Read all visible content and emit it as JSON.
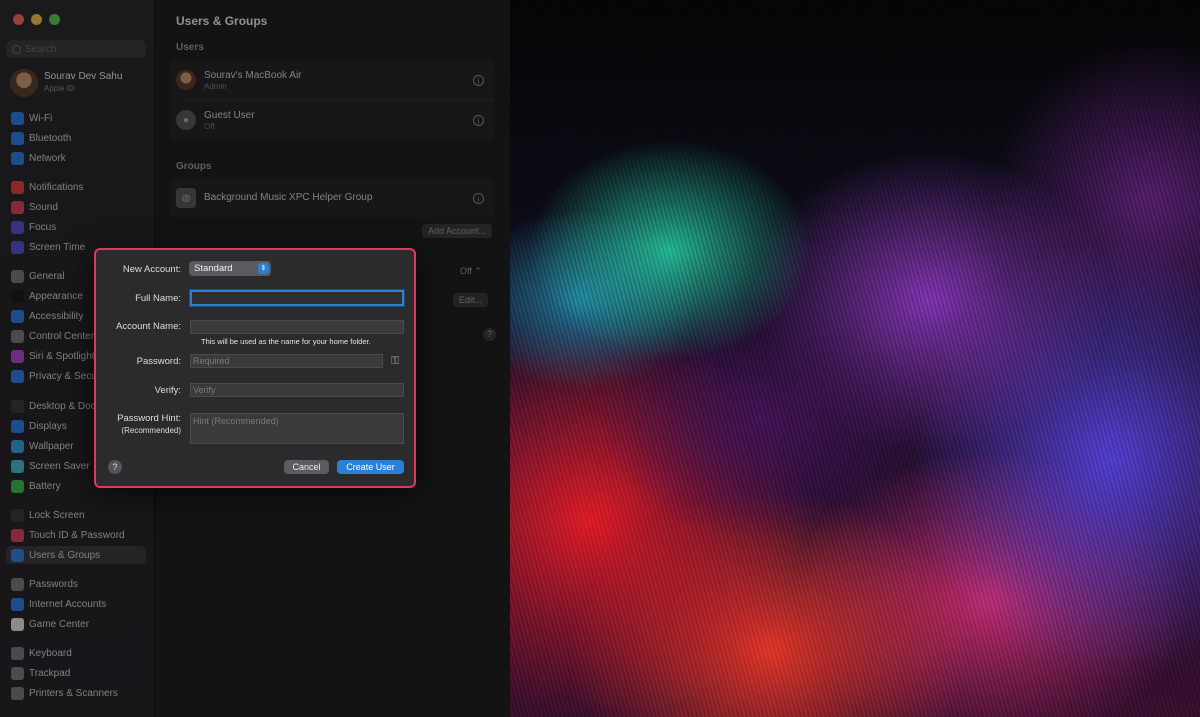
{
  "window": {
    "search_placeholder": "Search",
    "profile": {
      "name": "Sourav Dev Sahu",
      "subtitle": "Apple ID"
    },
    "sidebar": {
      "items": [
        {
          "label": "Wi-Fi",
          "color": "#2f7fe0"
        },
        {
          "label": "Bluetooth",
          "color": "#2f7fe0"
        },
        {
          "label": "Network",
          "color": "#2f7fe0"
        },
        {
          "label": "Notifications",
          "color": "#e04040"
        },
        {
          "label": "Sound",
          "color": "#e04060"
        },
        {
          "label": "Focus",
          "color": "#5a4fd0"
        },
        {
          "label": "Screen Time",
          "color": "#5a4fd0"
        },
        {
          "label": "General",
          "color": "#7a7a7e"
        },
        {
          "label": "Appearance",
          "color": "#1c1c1e"
        },
        {
          "label": "Accessibility",
          "color": "#2f7fe0"
        },
        {
          "label": "Control Center",
          "color": "#7a7a7e"
        },
        {
          "label": "Siri & Spotlight",
          "color": "#b04ad0"
        },
        {
          "label": "Privacy & Security",
          "color": "#2f7fe0"
        },
        {
          "label": "Desktop & Dock",
          "color": "#3a3a3e"
        },
        {
          "label": "Displays",
          "color": "#2f7fe0"
        },
        {
          "label": "Wallpaper",
          "color": "#35a0d8"
        },
        {
          "label": "Screen Saver",
          "color": "#45b8c8"
        },
        {
          "label": "Battery",
          "color": "#3fb950"
        },
        {
          "label": "Lock Screen",
          "color": "#3a3a3e"
        },
        {
          "label": "Touch ID & Password",
          "color": "#e04060"
        },
        {
          "label": "Users & Groups",
          "color": "#2f7fe0"
        },
        {
          "label": "Passwords",
          "color": "#7a7a7e"
        },
        {
          "label": "Internet Accounts",
          "color": "#2f7fe0"
        },
        {
          "label": "Game Center",
          "color": "#e0e0e0"
        },
        {
          "label": "Keyboard",
          "color": "#7a7a7e"
        },
        {
          "label": "Trackpad",
          "color": "#7a7a7e"
        },
        {
          "label": "Printers & Scanners",
          "color": "#7a7a7e"
        }
      ],
      "selected": "Users & Groups"
    },
    "content": {
      "title": "Users & Groups",
      "users_heading": "Users",
      "users": [
        {
          "name": "Sourav's MacBook Air",
          "role": "Admin"
        },
        {
          "name": "Guest User",
          "role": "Off"
        }
      ],
      "groups_heading": "Groups",
      "groups": [
        {
          "name": "Background Music XPC Helper Group"
        }
      ],
      "add_account_label": "Add Account...",
      "autologin_value": "Off",
      "edit_label": "Edit...",
      "help_glyph": "?"
    }
  },
  "dialog": {
    "new_account_label": "New Account:",
    "account_type": "Standard",
    "full_name_label": "Full Name:",
    "full_name_value": "",
    "account_name_label": "Account Name:",
    "account_name_value": "",
    "account_name_note": "This will be used as the name for your home folder.",
    "password_label": "Password:",
    "password_placeholder": "Required",
    "verify_label": "Verify:",
    "verify_placeholder": "Verify",
    "hint_label": "Password Hint:",
    "hint_sublabel": "(Recommended)",
    "hint_placeholder": "Hint (Recommended)",
    "help_glyph": "?",
    "cancel_label": "Cancel",
    "create_label": "Create User"
  }
}
